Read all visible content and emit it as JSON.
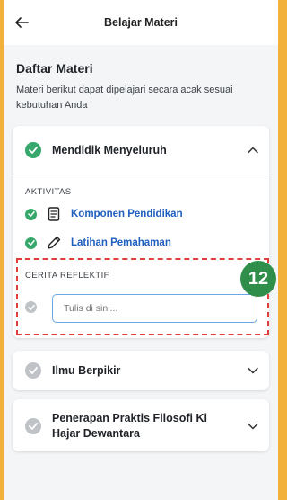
{
  "header": {
    "title": "Belajar Materi"
  },
  "section": {
    "title": "Daftar Materi",
    "description": "Materi berikut dapat dipelajari secara acak sesuai kebutuhan Anda"
  },
  "modules": [
    {
      "label": "Mendidik Menyeluruh",
      "completed": true,
      "expanded": true,
      "activities_heading": "AKTIVITAS",
      "activities": [
        {
          "label": "Komponen Pendidikan",
          "icon": "document-icon",
          "completed": true
        },
        {
          "label": "Latihan Pemahaman",
          "icon": "pencil-icon",
          "completed": true
        }
      ],
      "reflection_heading": "CERITA REFLEKTIF",
      "reflection_placeholder": "Tulis di sini..."
    },
    {
      "label": "Ilmu Berpikir",
      "completed": false,
      "expanded": false
    },
    {
      "label": "Penerapan Praktis Filosofi Ki Hajar Dewantara",
      "completed": false,
      "expanded": false
    }
  ],
  "annotation": {
    "step_number": "12"
  },
  "colors": {
    "frame": "#f2b13b",
    "check_done": "#36a86b",
    "check_todo": "#bfc3c8",
    "link": "#1f5fbf",
    "highlight_border": "#e23d3d",
    "badge": "#2f8f4a"
  }
}
